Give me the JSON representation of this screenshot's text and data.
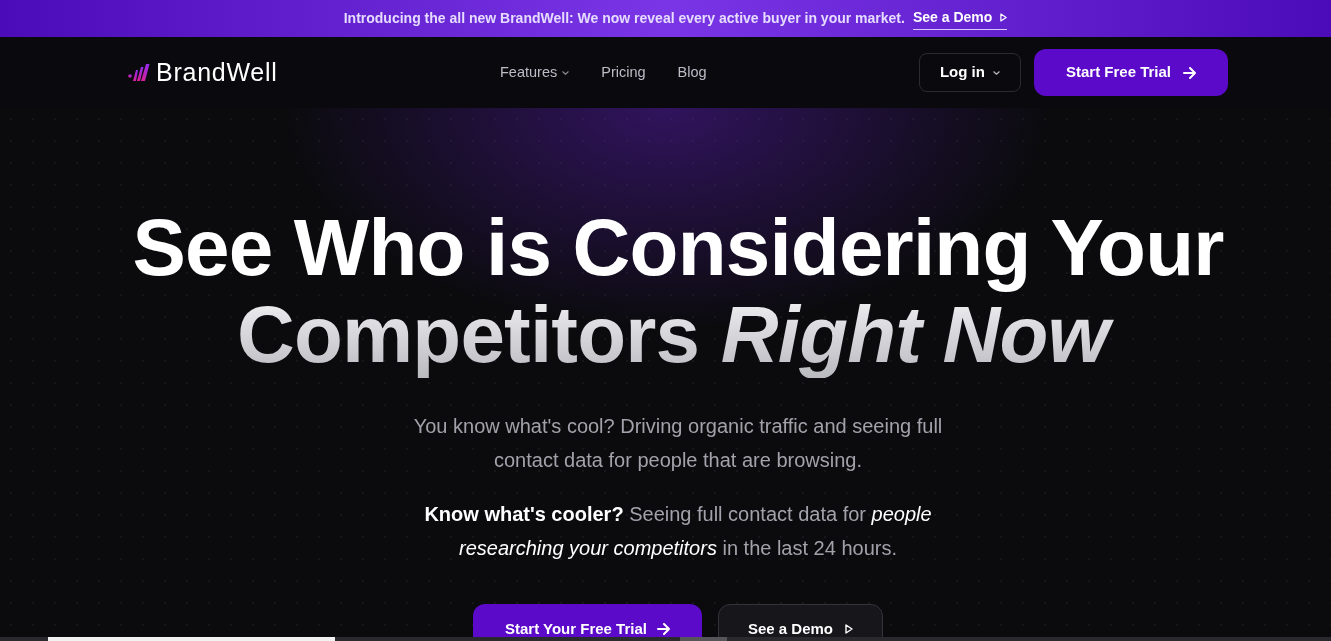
{
  "announcement": {
    "text": "Introducing the all new BrandWell: We now reveal every active buyer in your market.",
    "link": "See a Demo"
  },
  "nav": {
    "logo": "BrandWell",
    "links": [
      {
        "label": "Features",
        "dropdown": true
      },
      {
        "label": "Pricing",
        "dropdown": false
      },
      {
        "label": "Blog",
        "dropdown": false
      }
    ],
    "login": {
      "label": "Log in",
      "dropdown": true
    },
    "cta": "Start Free Trial"
  },
  "hero": {
    "headline": {
      "line_1": "See Who is Considering Your",
      "line_2": "Competitors *Right Now*"
    },
    "paragraphs": [
      "You know what's cool? Driving organic traffic and seeing full contact data for people that are browsing.",
      "**Know what's cooler?** Seeing full contact data for *people researching your competitors* in the last 24 hours."
    ],
    "buttons": [
      {
        "label": "Start Your Free Trial",
        "kind": "primary"
      },
      {
        "label": "See a Demo",
        "kind": "secondary"
      }
    ]
  }
}
